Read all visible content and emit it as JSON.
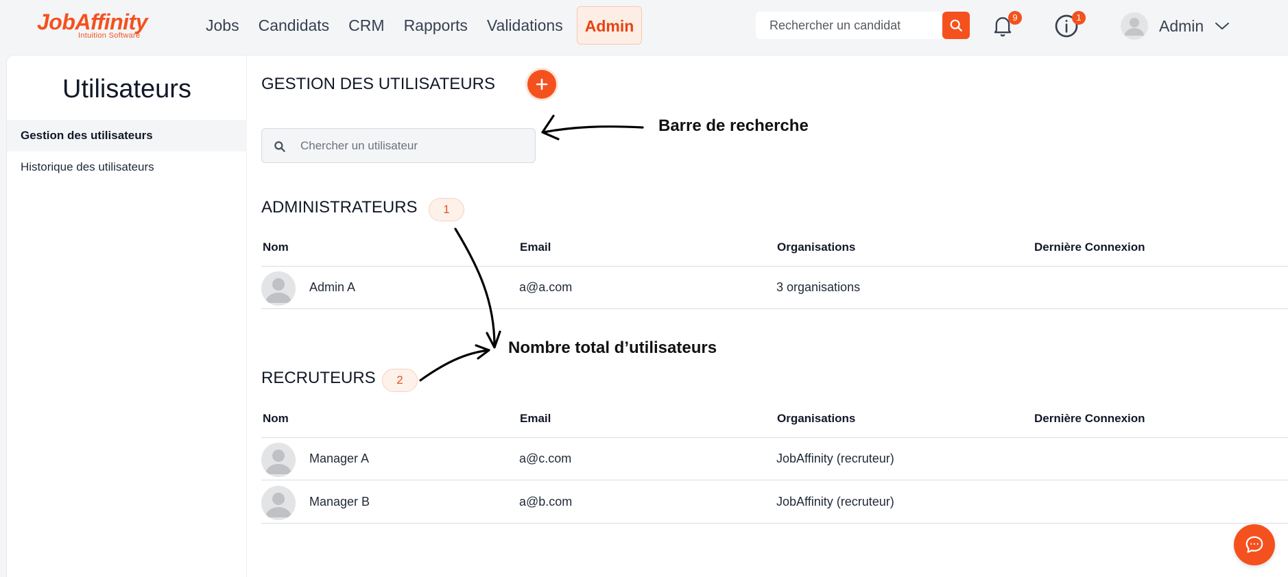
{
  "brand": {
    "name": "JobAffinity",
    "tagline": "Intuition Software",
    "accent": "#f4511e"
  },
  "nav": {
    "items": [
      {
        "label": "Jobs"
      },
      {
        "label": "Candidats"
      },
      {
        "label": "CRM"
      },
      {
        "label": "Rapports"
      },
      {
        "label": "Validations"
      },
      {
        "label": "Admin",
        "active": true
      }
    ]
  },
  "topbar": {
    "search_placeholder": "Rechercher un candidat",
    "search_icon": "search-icon",
    "notifications": {
      "icon": "bell-icon",
      "count": "9"
    },
    "info": {
      "icon": "info-icon",
      "count": "1"
    },
    "user": {
      "name": "Admin",
      "avatar_icon": "avatar-icon",
      "chevron_icon": "chevron-down-icon"
    }
  },
  "sidebar": {
    "title": "Utilisateurs",
    "items": [
      {
        "label": "Gestion des utilisateurs",
        "active": true
      },
      {
        "label": "Historique des utilisateurs"
      }
    ]
  },
  "main": {
    "title": "GESTION DES UTILISATEURS",
    "add_icon": "plus-icon",
    "search_placeholder": "Chercher un utilisateur",
    "columns": [
      "Nom",
      "Email",
      "Organisations",
      "Dernière Connexion"
    ],
    "sections": [
      {
        "title": "ADMINISTRATEURS",
        "count": "1",
        "rows": [
          {
            "name": "Admin A",
            "email": "a@a.com",
            "organisations": "3 organisations",
            "last_login": ""
          }
        ]
      },
      {
        "title": "RECRUTEURS",
        "count": "2",
        "rows": [
          {
            "name": "Manager A",
            "email": "a@c.com",
            "organisations": "JobAffinity (recruteur)",
            "last_login": ""
          },
          {
            "name": "Manager B",
            "email": "a@b.com",
            "organisations": "JobAffinity (recruteur)",
            "last_login": ""
          }
        ]
      }
    ]
  },
  "annotations": {
    "search_bar": "Barre de recherche",
    "total_users": "Nombre total d’utilisateurs"
  },
  "chat": {
    "icon": "chat-bubble-icon"
  }
}
